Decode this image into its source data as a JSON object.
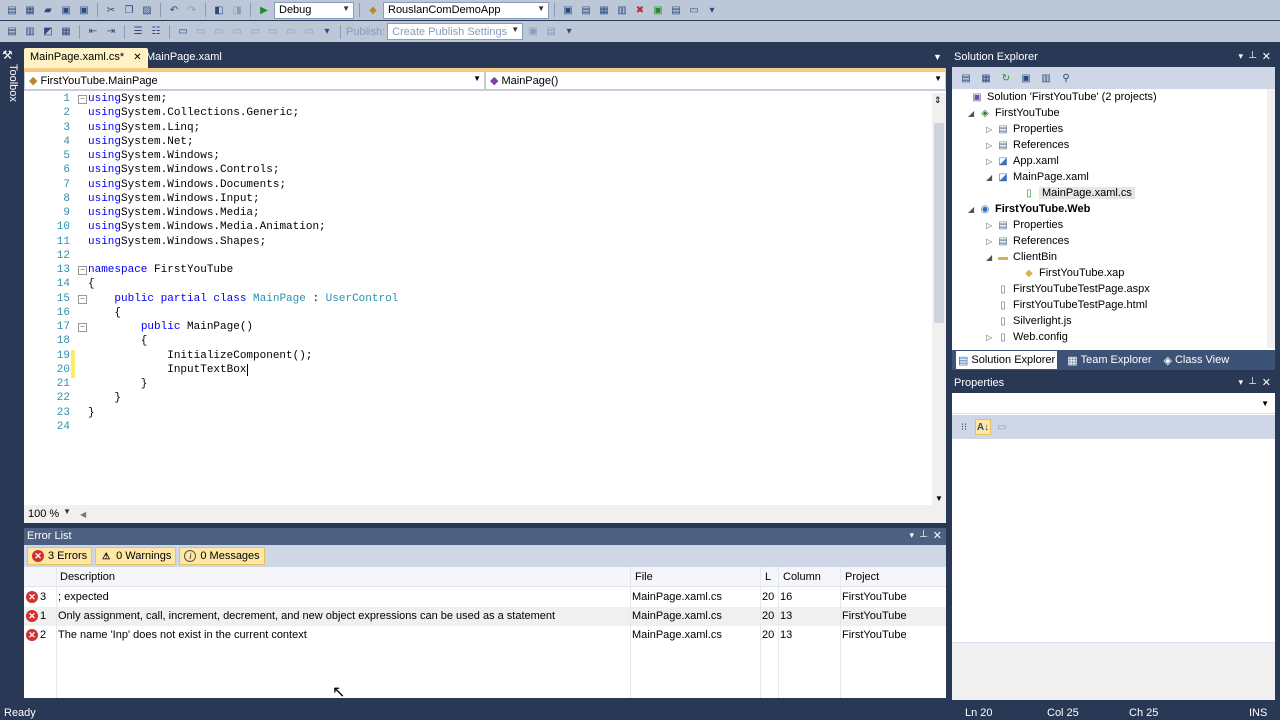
{
  "toolbar": {
    "config": "Debug",
    "startup_project": "RouslanComDemoApp",
    "publish_label": "Publish:",
    "publish_settings": "Create Publish Settings"
  },
  "toolbox": {
    "label": "Toolbox"
  },
  "tabs": [
    {
      "label": "MainPage.xaml.cs*",
      "active": true
    },
    {
      "label": "MainPage.xaml",
      "active": false
    }
  ],
  "editor": {
    "type_nav": "FirstYouTube.MainPage",
    "member_nav": "MainPage()",
    "zoom": "100 %",
    "lines": [
      {
        "n": "1",
        "fold": "−",
        "parts": [
          [
            "kw",
            "using"
          ],
          [
            "",
            "System;"
          ]
        ]
      },
      {
        "n": "2",
        "parts": [
          [
            "kw",
            "using"
          ],
          [
            "",
            "System.Collections.Generic;"
          ]
        ]
      },
      {
        "n": "3",
        "parts": [
          [
            "kw",
            "using"
          ],
          [
            "",
            "System.Linq;"
          ]
        ]
      },
      {
        "n": "4",
        "parts": [
          [
            "kw",
            "using"
          ],
          [
            "",
            "System.Net;"
          ]
        ]
      },
      {
        "n": "5",
        "parts": [
          [
            "kw",
            "using"
          ],
          [
            "",
            "System.Windows;"
          ]
        ]
      },
      {
        "n": "6",
        "parts": [
          [
            "kw",
            "using"
          ],
          [
            "",
            "System.Windows.Controls;"
          ]
        ]
      },
      {
        "n": "7",
        "parts": [
          [
            "kw",
            "using"
          ],
          [
            "",
            "System.Windows.Documents;"
          ]
        ]
      },
      {
        "n": "8",
        "parts": [
          [
            "kw",
            "using"
          ],
          [
            "",
            "System.Windows.Input;"
          ]
        ]
      },
      {
        "n": "9",
        "parts": [
          [
            "kw",
            "using"
          ],
          [
            "",
            "System.Windows.Media;"
          ]
        ]
      },
      {
        "n": "10",
        "parts": [
          [
            "kw",
            "using"
          ],
          [
            "",
            "System.Windows.Media.Animation;"
          ]
        ]
      },
      {
        "n": "11",
        "parts": [
          [
            "kw",
            "using"
          ],
          [
            "",
            "System.Windows.Shapes;"
          ]
        ]
      },
      {
        "n": "12",
        "parts": []
      },
      {
        "n": "13",
        "fold": "−",
        "parts": [
          [
            "kw",
            "namespace"
          ],
          [
            "",
            " FirstYouTube"
          ]
        ]
      },
      {
        "n": "14",
        "parts": [
          [
            "",
            "{"
          ]
        ]
      },
      {
        "n": "15",
        "fold": "−",
        "parts": [
          [
            "",
            "    "
          ],
          [
            "kw",
            "public partial class"
          ],
          [
            "",
            " "
          ],
          [
            "ty",
            "MainPage"
          ],
          [
            "",
            " : "
          ],
          [
            "ty",
            "UserControl"
          ]
        ]
      },
      {
        "n": "16",
        "parts": [
          [
            "",
            "    {"
          ]
        ]
      },
      {
        "n": "17",
        "fold": "−",
        "parts": [
          [
            "",
            "        "
          ],
          [
            "kw",
            "public"
          ],
          [
            "",
            " MainPage()"
          ]
        ]
      },
      {
        "n": "18",
        "parts": [
          [
            "",
            "        {"
          ]
        ]
      },
      {
        "n": "19",
        "changed": true,
        "parts": [
          [
            "",
            "            InitializeComponent();"
          ]
        ]
      },
      {
        "n": "20",
        "changed": true,
        "parts": [
          [
            "",
            "            InputTextBox"
          ]
        ]
      },
      {
        "n": "21",
        "parts": [
          [
            "",
            "        }"
          ]
        ]
      },
      {
        "n": "22",
        "parts": [
          [
            "",
            "    }"
          ]
        ]
      },
      {
        "n": "23",
        "parts": [
          [
            "",
            "}"
          ]
        ]
      },
      {
        "n": "24",
        "parts": []
      }
    ]
  },
  "error_list": {
    "title": "Error List",
    "filters": {
      "errors": "3 Errors",
      "warnings": "0 Warnings",
      "messages": "0 Messages"
    },
    "columns": {
      "description": "Description",
      "file": "File",
      "line": "L",
      "column": "Column",
      "project": "Project"
    },
    "rows": [
      {
        "num": "3",
        "description": "; expected",
        "file": "MainPage.xaml.cs",
        "line": "20",
        "column": "16",
        "project": "FirstYouTube"
      },
      {
        "num": "1",
        "description": "Only assignment, call, increment, decrement, and new object expressions can be used as a statement",
        "file": "MainPage.xaml.cs",
        "line": "20",
        "column": "13",
        "project": "FirstYouTube"
      },
      {
        "num": "2",
        "description": "The name 'Inp' does not exist in the current context",
        "file": "MainPage.xaml.cs",
        "line": "20",
        "column": "13",
        "project": "FirstYouTube"
      }
    ]
  },
  "solution_explorer": {
    "title": "Solution Explorer",
    "nodes": [
      {
        "label": "Solution 'FirstYouTube' (2 projects)",
        "icon": "solution-icon",
        "glyph": "▣",
        "color": "#6a4fa0"
      },
      {
        "label": "FirstYouTube",
        "icon": "project-icon",
        "glyph": "◈",
        "color": "#2f7d32",
        "tw": "◢"
      },
      {
        "label": "Properties",
        "icon": "properties-icon",
        "glyph": "▤",
        "color": "#5a6e8c",
        "tw": "▷"
      },
      {
        "label": "References",
        "icon": "references-icon",
        "glyph": "▤",
        "color": "#5a6e8c",
        "tw": "▷"
      },
      {
        "label": "App.xaml",
        "icon": "xaml-file-icon",
        "glyph": "◪",
        "color": "#3b6fb6",
        "tw": "▷"
      },
      {
        "label": "MainPage.xaml",
        "icon": "xaml-file-icon",
        "glyph": "◪",
        "color": "#3b6fb6",
        "tw": "◢"
      },
      {
        "label": "MainPage.xaml.cs",
        "icon": "cs-file-icon",
        "glyph": "▯",
        "color": "#2a8a2a",
        "selected": true
      },
      {
        "label": "FirstYouTube.Web",
        "icon": "web-project-icon",
        "glyph": "◉",
        "color": "#2a6fb6",
        "tw": "◢",
        "bold": true
      },
      {
        "label": "Properties",
        "icon": "properties-icon",
        "glyph": "▤",
        "color": "#5a6e8c",
        "tw": "▷"
      },
      {
        "label": "References",
        "icon": "references-icon",
        "glyph": "▤",
        "color": "#5a6e8c",
        "tw": "▷"
      },
      {
        "label": "ClientBin",
        "icon": "folder-icon",
        "glyph": "▬",
        "color": "#d8b24a",
        "tw": "◢"
      },
      {
        "label": "FirstYouTube.xap",
        "icon": "xap-file-icon",
        "glyph": "◆",
        "color": "#d8b24a"
      },
      {
        "label": "FirstYouTubeTestPage.aspx",
        "icon": "aspx-file-icon",
        "glyph": "▯",
        "color": "#5a6e8c"
      },
      {
        "label": "FirstYouTubeTestPage.html",
        "icon": "html-file-icon",
        "glyph": "▯",
        "color": "#5a6e8c"
      },
      {
        "label": "Silverlight.js",
        "icon": "js-file-icon",
        "glyph": "▯",
        "color": "#5a6e8c"
      },
      {
        "label": "Web.config",
        "icon": "config-file-icon",
        "glyph": "▯",
        "color": "#5a6e8c",
        "tw": "▷"
      }
    ]
  },
  "bottom_tabs": {
    "solution_explorer": "Solution Explorer",
    "team_explorer": "Team Explorer",
    "class_view": "Class View"
  },
  "properties": {
    "title": "Properties"
  },
  "status": {
    "ready": "Ready",
    "ln": "Ln 20",
    "col": "Col 25",
    "ch": "Ch 25",
    "ins": "INS"
  },
  "colors": {
    "accent": "#293955",
    "tab_active": "#fff3c5",
    "error": "#d23030"
  }
}
